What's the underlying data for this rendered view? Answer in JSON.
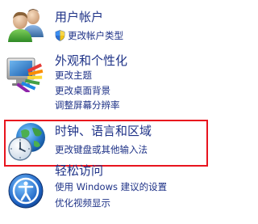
{
  "categories": [
    {
      "id": "user-accounts",
      "icon": "users-icon",
      "title": "用户帐户",
      "links": [
        {
          "label": "更改帐户类型",
          "icon": "uac-shield-icon"
        }
      ]
    },
    {
      "id": "appearance",
      "icon": "appearance-monitor-icon",
      "title": "外观和个性化",
      "links": [
        {
          "label": "更改主题"
        },
        {
          "label": "更改桌面背景"
        },
        {
          "label": "调整屏幕分辨率"
        }
      ]
    },
    {
      "id": "clock-language-region",
      "icon": "clock-globe-icon",
      "title": "时钟、语言和区域",
      "highlighted": true,
      "links": [
        {
          "label": "更改键盘或其他输入法"
        }
      ]
    },
    {
      "id": "ease-of-access",
      "icon": "ease-of-access-icon",
      "title": "轻松访问",
      "links": [
        {
          "label": "使用 Windows 建议的设置"
        },
        {
          "label": "优化视频显示"
        }
      ]
    }
  ],
  "colors": {
    "link": "#1e3287",
    "highlight_border": "#e8141e",
    "background": "#ffffff"
  }
}
